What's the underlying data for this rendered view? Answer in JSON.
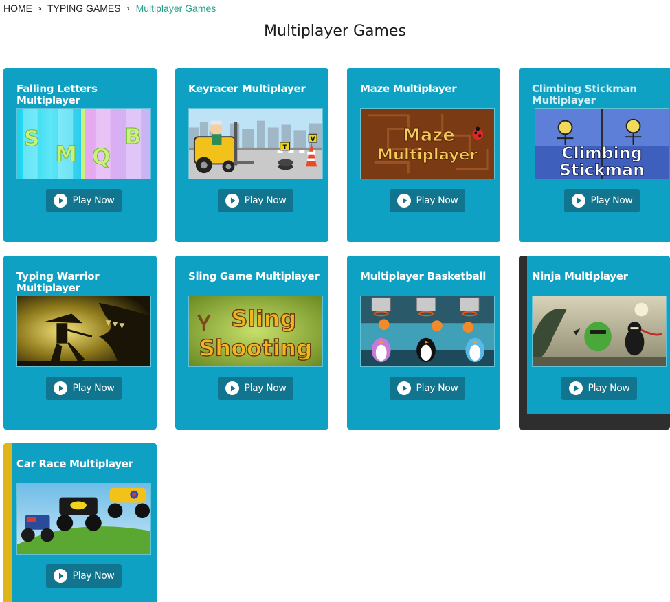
{
  "breadcrumb": {
    "home": "HOME",
    "typing_games": "TYPING GAMES",
    "current": "Multiplayer Games"
  },
  "page_title": "Multiplayer Games",
  "play_label": "Play Now",
  "colors": {
    "card_bg": "#0fa1c4",
    "button_bg": "#11758f",
    "hover_frame": "#2e2e2e",
    "accent": "#e0b41b",
    "breadcrumb_current": "#2aa08a"
  },
  "games": [
    {
      "title": "Falling Letters Multiplayer",
      "thumb_text": [
        "S",
        "M",
        "Q",
        "B"
      ]
    },
    {
      "title": "Keyracer Multiplayer",
      "thumb_text": [
        "T",
        "V"
      ]
    },
    {
      "title": "Maze Multiplayer",
      "thumb_text": [
        "Maze",
        "Multiplayer"
      ]
    },
    {
      "title": "Climbing Stickman Multiplayer",
      "thumb_text": [
        "Climbing",
        "Stickman"
      ]
    },
    {
      "title": "Typing Warrior Multiplayer",
      "thumb_text": []
    },
    {
      "title": "Sling Game Multiplayer",
      "thumb_text": [
        "Sling",
        "Shooting"
      ]
    },
    {
      "title": "Multiplayer Basketball",
      "thumb_text": []
    },
    {
      "title": "Ninja Multiplayer",
      "thumb_text": []
    },
    {
      "title": "Car Race Multiplayer",
      "thumb_text": []
    }
  ]
}
